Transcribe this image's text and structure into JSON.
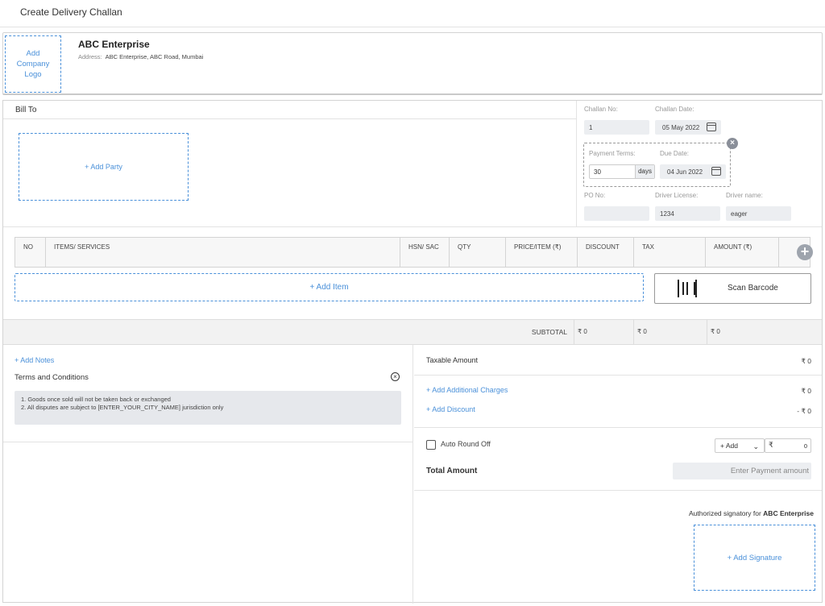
{
  "page": {
    "title": "Create Delivery Challan"
  },
  "company": {
    "logo_label": "Add Company Logo",
    "name": "ABC Enterprise",
    "address_label": "Address:",
    "address": "ABC Enterprise, ABC Road, Mumbai"
  },
  "bill": {
    "label": "Bill To",
    "add_party": "+ Add Party"
  },
  "challan": {
    "no_label": "Challan No:",
    "no_value": "1",
    "date_label": "Challan Date:",
    "date_value": "05 May 2022",
    "payment_terms_label": "Payment Terms:",
    "payment_terms_value": "30",
    "days_unit": "days",
    "due_label": "Due Date:",
    "due_value": "04 Jun 2022",
    "po_label": "PO No:",
    "po_value": "",
    "license_label": "Driver License:",
    "license_value": "1234",
    "driver_label": "Driver name:",
    "driver_value": "eager"
  },
  "items": {
    "columns": [
      "NO",
      "ITEMS/ SERVICES",
      "HSN/ SAC",
      "QTY",
      "PRICE/ITEM (₹)",
      "DISCOUNT",
      "TAX",
      "AMOUNT (₹)"
    ],
    "add_item": "+ Add Item",
    "scan_barcode": "Scan Barcode"
  },
  "subtotal": {
    "label": "SUBTOTAL",
    "discount": "₹ 0",
    "tax": "₹ 0",
    "amount": "₹ 0"
  },
  "notes": {
    "add_notes": "+ Add Notes",
    "terms_title": "Terms and Conditions",
    "terms_lines": [
      "1. Goods once sold will not be taken back or exchanged",
      "2. All disputes are subject to [ENTER_YOUR_CITY_NAME] jurisdiction only"
    ]
  },
  "summary": {
    "taxable_label": "Taxable Amount",
    "taxable_value": "₹ 0",
    "add_charges": "+ Add Additional Charges",
    "charges_value": "₹ 0",
    "add_discount": "+ Add Discount",
    "discount_value": "- ₹ 0",
    "round_off_label": "Auto Round Off",
    "round_mode": "+ Add",
    "currency": "₹",
    "round_value": "0",
    "total_label": "Total Amount",
    "payment_placeholder": "Enter Payment amount",
    "signatory_prefix": "Authorized signatory for",
    "signatory_company": "ABC Enterprise",
    "add_signature": "+ Add Signature"
  }
}
